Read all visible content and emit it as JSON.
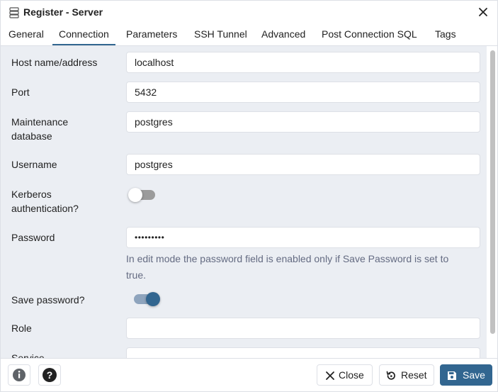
{
  "dialog": {
    "title": "Register - Server",
    "close_icon": "close-icon",
    "title_icon": "server-icon"
  },
  "tabs": [
    {
      "label": "General",
      "active": false
    },
    {
      "label": "Connection",
      "active": true
    },
    {
      "label": "Parameters",
      "active": false
    },
    {
      "label": "SSH Tunnel",
      "active": false
    },
    {
      "label": "Advanced",
      "active": false
    },
    {
      "label": "Post Connection SQL",
      "active": false
    },
    {
      "label": "Tags",
      "active": false
    }
  ],
  "form": {
    "host": {
      "label": "Host name/address",
      "value": "localhost"
    },
    "port": {
      "label": "Port",
      "value": "5432"
    },
    "maintenance_db": {
      "label_line1": "Maintenance",
      "label_line2": "database",
      "value": "postgres"
    },
    "username": {
      "label": "Username",
      "value": "postgres"
    },
    "kerberos": {
      "label_line1": "Kerberos",
      "label_line2": "authentication?",
      "enabled": false
    },
    "password": {
      "label": "Password",
      "value": "•••••••••"
    },
    "password_help_line1": "In edit mode the password field is enabled only if Save Password is set to",
    "password_help_line2": "true.",
    "save_password": {
      "label": "Save password?",
      "enabled": true
    },
    "role": {
      "label": "Role",
      "value": ""
    },
    "service": {
      "label": "Service",
      "value": ""
    }
  },
  "footer": {
    "info_icon": "info-icon",
    "help_icon": "help-icon",
    "close_label": "Close",
    "reset_label": "Reset",
    "save_label": "Save"
  },
  "colors": {
    "accent": "#326690",
    "content_bg": "#ebeef3",
    "border": "#dde0e6",
    "help_text": "#646b82"
  }
}
